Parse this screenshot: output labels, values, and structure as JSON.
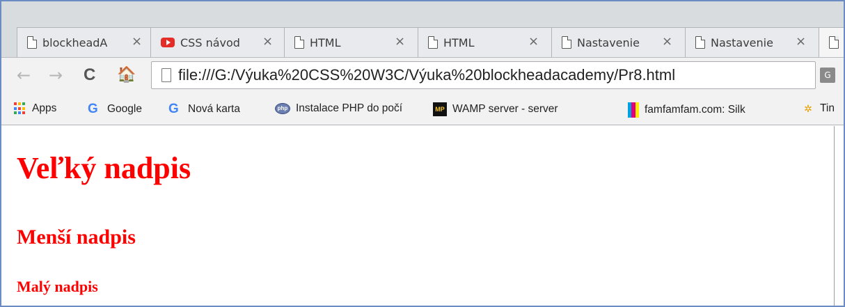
{
  "tabs": [
    {
      "title": "blockheadA",
      "icon": "page-icon",
      "close": "×"
    },
    {
      "title": "CSS návod",
      "icon": "youtube-icon",
      "close": "×"
    },
    {
      "title": "HTML",
      "icon": "page-icon",
      "close": "×"
    },
    {
      "title": "HTML",
      "icon": "page-icon",
      "close": "×"
    },
    {
      "title": "Nastavenie",
      "icon": "page-icon",
      "close": "×"
    },
    {
      "title": "Nastavenie",
      "icon": "page-icon",
      "close": "×"
    }
  ],
  "toolbar": {
    "back": "←",
    "forward": "→",
    "reload": "C",
    "home": "🏠",
    "url": "file:///G:/Výuka%20CSS%20W3C/Výuka%20blockheadacademy/Pr8.html"
  },
  "bookmarks": [
    {
      "label": "Apps",
      "icon": "apps-grid-icon"
    },
    {
      "label": "Google",
      "icon": "google-icon"
    },
    {
      "label": "Nová karta",
      "icon": "google-icon"
    },
    {
      "label": "Instalace PHP do počí",
      "icon": "php-icon"
    },
    {
      "label": "WAMP server - server",
      "icon": "mp-icon"
    },
    {
      "label": "famfamfam.com: Silk",
      "icon": "famfamfam-icon"
    },
    {
      "label": "Tin",
      "icon": "tiny-icon"
    }
  ],
  "page": {
    "h1": "Veľký nadpis",
    "h2": "Menší nadpis",
    "h3": "Malý nadpis"
  },
  "colors": {
    "heading": "#ff0000",
    "frame_border": "#6b8cc2"
  }
}
